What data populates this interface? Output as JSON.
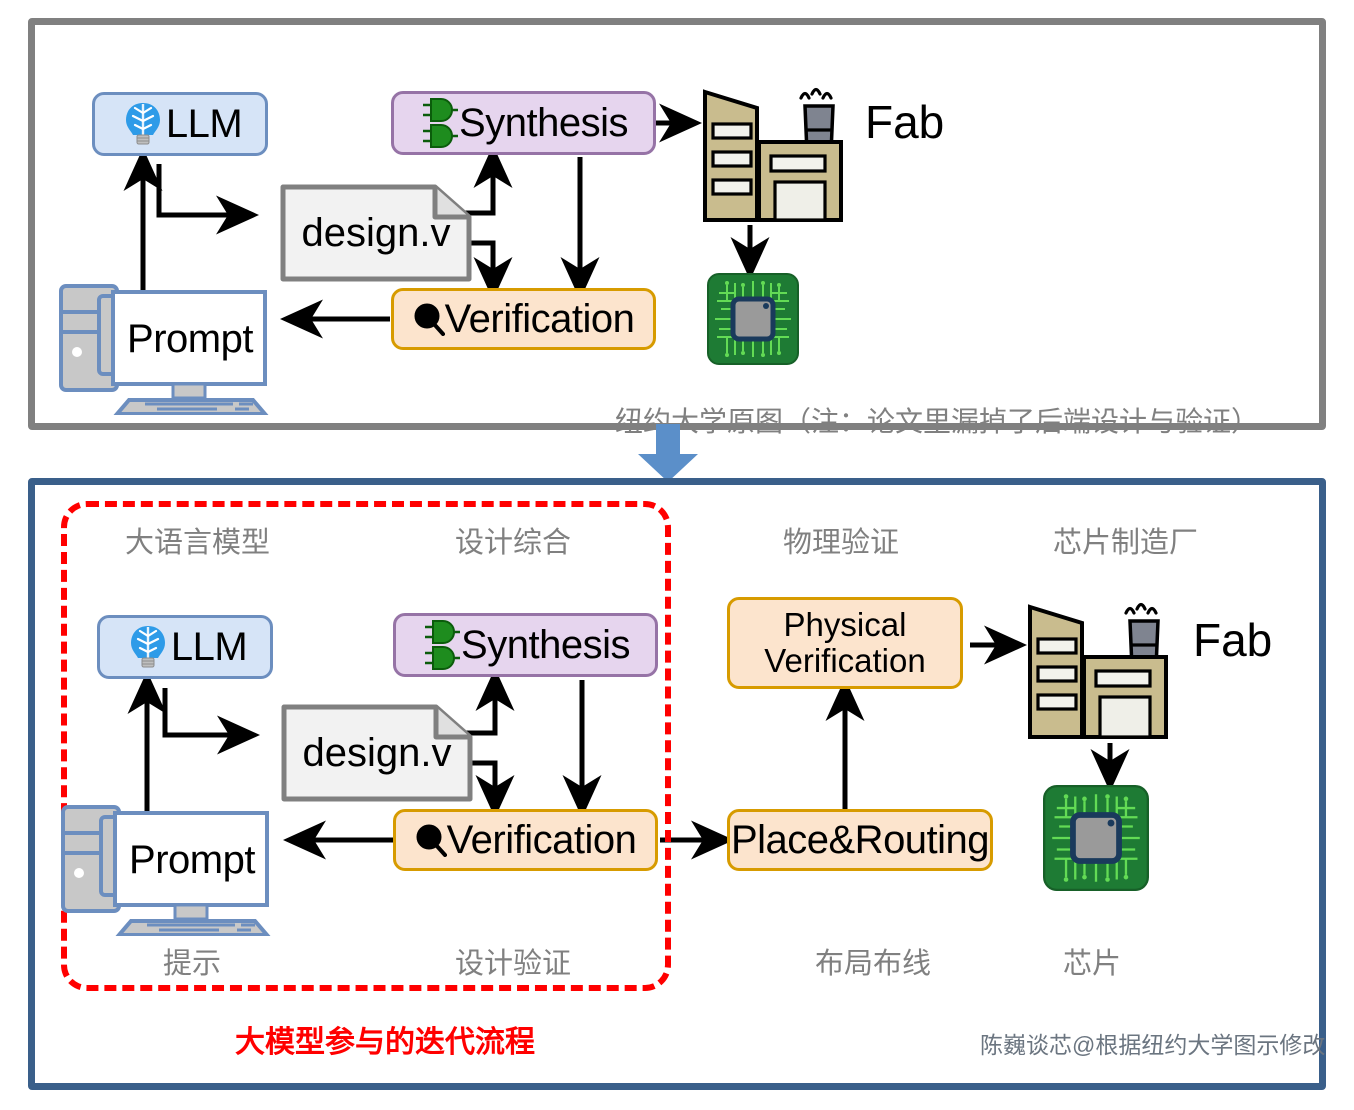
{
  "top_panel": {
    "nodes": {
      "llm": "LLM",
      "synthesis": "Synthesis",
      "design_file": "design.v",
      "verification": "Verification",
      "prompt": "Prompt",
      "fab": "Fab"
    },
    "caption": "纽约大学原图（注：论文里漏掉了后端设计与验证）",
    "border_color": "#808080"
  },
  "bottom_panel": {
    "nodes": {
      "llm": "LLM",
      "synthesis": "Synthesis",
      "design_file": "design.v",
      "verification": "Verification",
      "prompt": "Prompt",
      "physical_verification": "Physical\nVerification",
      "physical_verification_line1": "Physical",
      "physical_verification_line2": "Verification",
      "place_routing": "Place&Routing",
      "fab": "Fab"
    },
    "stage_labels_top": {
      "llm": "大语言模型",
      "synthesis": "设计综合",
      "physical_verification": "物理验证",
      "fab": "芯片制造厂"
    },
    "stage_labels_bottom": {
      "prompt": "提示",
      "verification": "设计验证",
      "place_routing": "布局布线",
      "chip": "芯片"
    },
    "region_caption": "大模型参与的迭代流程",
    "credit": "陈巍谈芯@根据纽约大学图示修改",
    "border_color": "#3A5F8A",
    "region_border_color": "#FF0000"
  },
  "colors": {
    "llm_fill": "#D6E4F7",
    "llm_stroke": "#6C8EBF",
    "synthesis_fill": "#E6D5EE",
    "synthesis_stroke": "#9673A6",
    "verification_fill": "#FCE4CD",
    "verification_stroke": "#D79B00",
    "document_fill": "#F2F2F2",
    "document_stroke": "#808080",
    "transition_arrow": "#5B8FC9",
    "factory_body": "#C9BC8E",
    "chimney": "#7F8490",
    "chip_board": "#1E7B34",
    "gate_green": "#1E8C1E",
    "brain_blue": "#2E9BE8"
  },
  "icons": {
    "llm": "brain-lightbulb-icon",
    "synthesis": "logic-gate-icon",
    "verification": "magnifier-icon",
    "prompt": "desktop-computer-icon",
    "fab": "factory-icon",
    "chip": "microchip-icon",
    "transition": "down-arrow-icon"
  }
}
